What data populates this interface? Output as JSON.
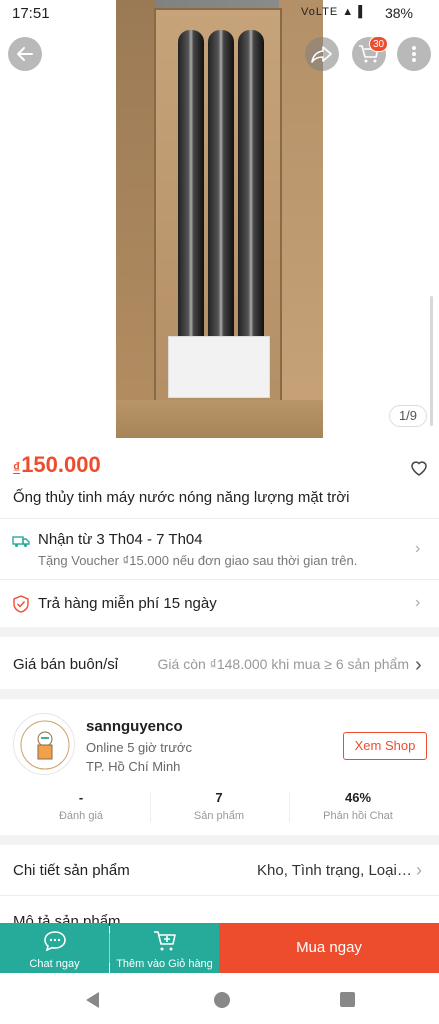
{
  "status_bar": {
    "time": "17:51",
    "signal_icons": "VoLTE ▲ ▌",
    "battery": "38%"
  },
  "gallery": {
    "page_indicator": "1/9"
  },
  "header": {
    "cart_count": "30"
  },
  "product": {
    "currency": "₫",
    "price": "150.000",
    "title": "Ống thủy tinh máy nước nóng năng lượng mặt trời"
  },
  "shipping": {
    "line1": "Nhận từ 3 Th04 - 7 Th04",
    "line2": "Tặng Voucher ₫15.000 nếu đơn giao sau thời gian trên."
  },
  "returns": {
    "text": "Trả hàng miễn phí 15 ngày"
  },
  "wholesale": {
    "label": "Giá bán buôn/sỉ",
    "value": "Giá còn ₫148.000 khi mua ≥ 6 sản phẩm"
  },
  "shop": {
    "name": "sannguyenco",
    "online": "Online 5 giờ trước",
    "location": "TP. Hồ Chí Minh",
    "view_shop": "Xem Shop",
    "stats": [
      {
        "value": "-",
        "label": "Đánh giá"
      },
      {
        "value": "7",
        "label": "Sản phẩm"
      },
      {
        "value": "46%",
        "label": "Phản hồi Chat"
      }
    ]
  },
  "details": {
    "label": "Chi tiết sản phẩm",
    "value": "Kho, Tình trạng, Loại b..."
  },
  "description": {
    "label": "Mô tả sản phẩm"
  },
  "bottom_bar": {
    "chat": "Chat ngay",
    "add_to_cart": "Thêm vào Giỏ hàng",
    "buy_now": "Mua ngay"
  },
  "colors": {
    "accent": "#ee4d2d",
    "teal": "#26aa99"
  }
}
